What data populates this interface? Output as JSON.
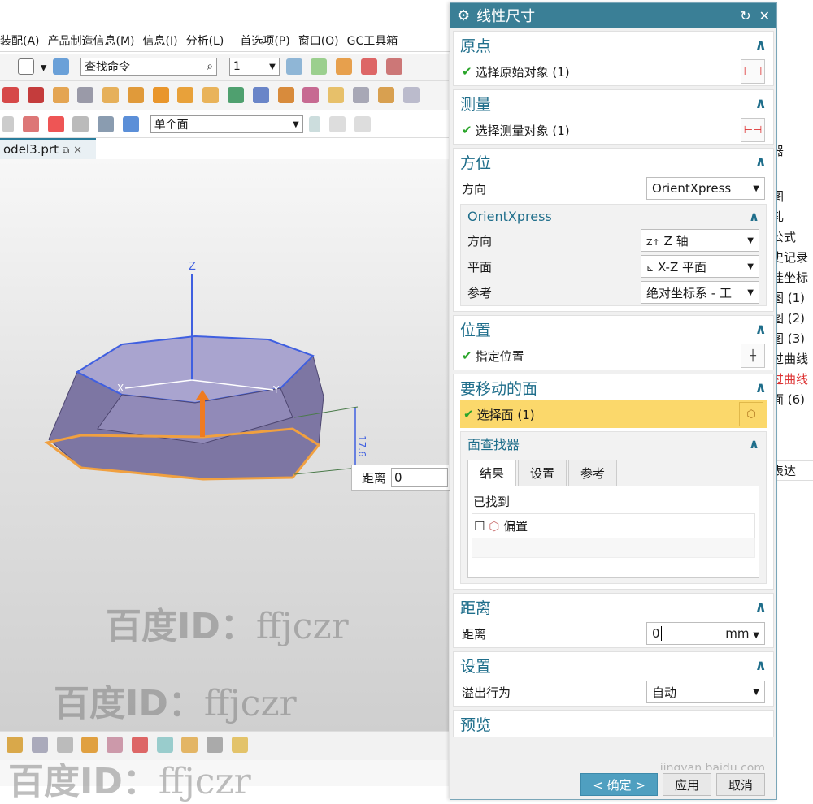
{
  "menubar": {
    "items": [
      "装配(A)",
      "产品制造信息(M)",
      "信息(I)",
      "分析(L)",
      "首选项(P)",
      "窗口(O)",
      "GC工具箱"
    ]
  },
  "toolbar": {
    "search_command": "查找命令",
    "layer_value": "1",
    "filter_value": "单个面"
  },
  "document_tab": {
    "label": "odel3.prt"
  },
  "viewport": {
    "axis_z": "Z",
    "axis_x": "X",
    "axis_y": "Y",
    "dimension_value": "17.6"
  },
  "distance_popup": {
    "label": "距离",
    "value": "0"
  },
  "right_strip": {
    "header": "器",
    "items": [
      "图",
      "轧",
      "公式",
      "史记录",
      "佳坐标",
      "图 (1)",
      "图 (2)",
      "图 (3)",
      "过曲线",
      "过曲线",
      "面 (6)"
    ],
    "column": "表达"
  },
  "watermarks": {
    "prefix": "百度ID：",
    "handle": "ffjczr"
  },
  "jingyan": "jingyan.baidu.com",
  "dialog": {
    "title": "线性尺寸",
    "origin": {
      "title": "原点",
      "item": "选择原始对象 (1)"
    },
    "measure": {
      "title": "测量",
      "item": "选择测量对象 (1)"
    },
    "orientation": {
      "title": "方位",
      "direction_label": "方向",
      "direction_value": "OrientXpress",
      "sub": {
        "title": "OrientXpress",
        "rows": [
          {
            "label": "方向",
            "value": "Z 轴"
          },
          {
            "label": "平面",
            "value": "X-Z 平面"
          },
          {
            "label": "参考",
            "value": "绝对坐标系 - 工"
          }
        ]
      }
    },
    "position": {
      "title": "位置",
      "item": "指定位置"
    },
    "faces": {
      "title": "要移动的面",
      "item": "选择面 (1)",
      "finder": {
        "title": "面查找器",
        "tabs": [
          "结果",
          "设置",
          "参考"
        ],
        "found_label": "已找到",
        "result": "偏置"
      }
    },
    "distance": {
      "title": "距离",
      "label": "距离",
      "value": "0",
      "unit": "mm"
    },
    "settings": {
      "title": "设置",
      "label": "溢出行为",
      "value": "自动"
    },
    "preview": {
      "title": "预览"
    },
    "buttons": {
      "ok": "< 确定 >",
      "apply": "应用",
      "cancel": "取消"
    }
  },
  "colors": {
    "accent": "#3a7f96",
    "highlight": "#fbd86b",
    "check": "#2aa52a",
    "model_face": "#8b84b0",
    "edge_blue": "#3f5fe0",
    "edge_orange": "#f0a040"
  }
}
